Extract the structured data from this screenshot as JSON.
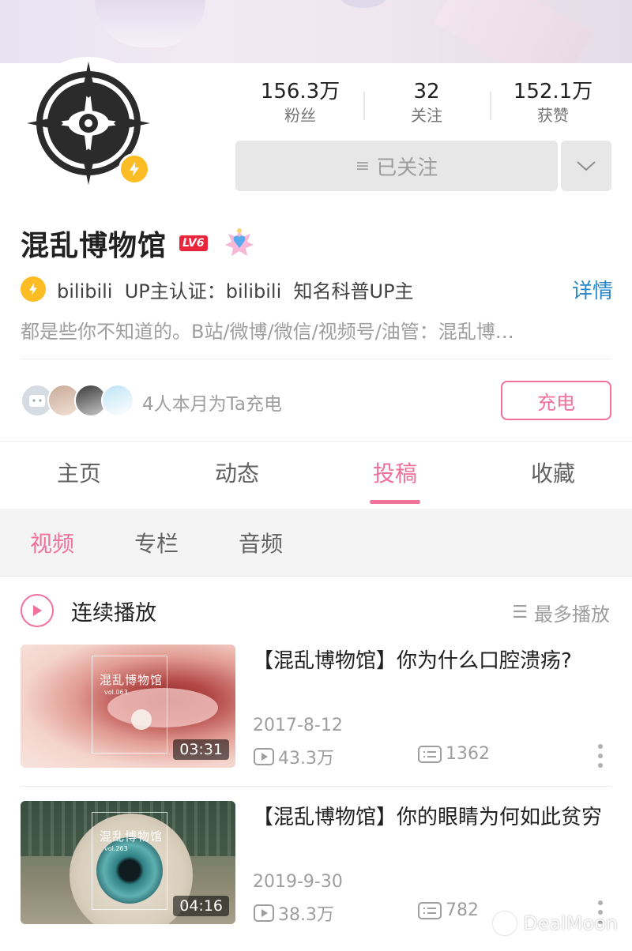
{
  "profile": {
    "stats": [
      {
        "value": "156.3万",
        "label": "粉丝"
      },
      {
        "value": "32",
        "label": "关注"
      },
      {
        "value": "152.1万",
        "label": "获赞"
      }
    ],
    "follow_label": "已关注",
    "name": "混乱博物馆",
    "level": "LV6",
    "cert_text": "bilibili  UP主认证：bilibili  知名科普UP主",
    "detail_link": "详情",
    "sign": "都是些你不知道的。B站/微博/微信/视频号/油管：混乱博…",
    "charge_text": "4人本月为Ta充电",
    "charge_button": "充电"
  },
  "tabs": [
    "主页",
    "动态",
    "投稿",
    "收藏"
  ],
  "active_tab": "投稿",
  "subtabs": [
    "视频",
    "专栏",
    "音频"
  ],
  "active_subtab": "视频",
  "playlist": {
    "play_label": "连续播放",
    "sort_label": "最多播放"
  },
  "videos": [
    {
      "title": "【混乱博物馆】你为什么口腔溃疡?",
      "date": "2017-8-12",
      "views": "43.3万",
      "comments": "1362",
      "duration": "03:31",
      "thumb_title": "混乱博物馆",
      "thumb_vol": "vol.063"
    },
    {
      "title": "【混乱博物馆】你的眼睛为何如此贫穷",
      "date": "2019-9-30",
      "views": "38.3万",
      "comments": "782",
      "duration": "04:16",
      "thumb_title": "混乱博物馆",
      "thumb_vol": "vol.263"
    }
  ],
  "watermark": "DealMoon",
  "colors": {
    "accent": "#f07199",
    "link": "#2b87c5",
    "verify": "#fbbd23",
    "level": "#e8253a"
  }
}
